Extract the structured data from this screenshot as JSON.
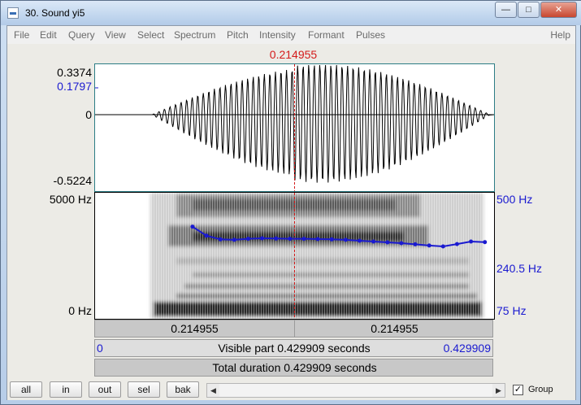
{
  "window": {
    "title": "30. Sound yi5",
    "controls": {
      "minimize": "—",
      "maximize": "□",
      "close": "✕"
    }
  },
  "menu": {
    "items": [
      "File",
      "Edit",
      "Query",
      "View",
      "Select",
      "Spectrum",
      "Pitch",
      "Intensity",
      "Formant",
      "Pulses"
    ],
    "help": "Help"
  },
  "cursor": {
    "time_label": "0.214955",
    "time": 0.214955,
    "color": "#d41b1b"
  },
  "waveform": {
    "top_label": "0.3374",
    "value_label": "0.1797",
    "zero_label": "0",
    "bottom_label": "-0.5224",
    "top": 0.3374,
    "bottom": -0.5224,
    "marked_value": 0.1797
  },
  "spectrogram": {
    "freq_top_label": "5000 Hz",
    "freq_bottom_label": "0 Hz",
    "pitch_top_label": "500 Hz",
    "pitch_mid_label": "240.5 Hz",
    "pitch_bottom_label": "75 Hz",
    "pitch_floor": 75,
    "pitch_ceiling": 500,
    "pitch_color": "#1a1ad0"
  },
  "chart_data": {
    "type": "line",
    "title": "",
    "xlabel": "",
    "ylabel": "",
    "xlim": [
      0,
      0.429909
    ],
    "ylim": [
      75,
      500
    ],
    "series": [
      {
        "x": [
          0.105,
          0.12,
          0.135,
          0.15,
          0.165,
          0.18,
          0.195,
          0.21,
          0.225,
          0.24,
          0.255,
          0.27,
          0.285,
          0.3,
          0.315,
          0.33,
          0.345,
          0.36,
          0.375,
          0.39,
          0.405,
          0.42
        ],
        "values": [
          300,
          262,
          248,
          246,
          250,
          252,
          251,
          250,
          250,
          249,
          248,
          246,
          243,
          240,
          237,
          234,
          230,
          226,
          223,
          231,
          240,
          238
        ]
      }
    ]
  },
  "selection": {
    "left_time": "0.214955",
    "right_time": "0.214955",
    "visible_start": "0",
    "visible_text": "Visible part 0.429909 seconds",
    "visible_end": "0.429909",
    "total_text": "Total duration 0.429909 seconds"
  },
  "toolbar": {
    "buttons": [
      "all",
      "in",
      "out",
      "sel",
      "bak"
    ],
    "scroll_left": "◀",
    "scroll_right": "▶",
    "group_label": "Group",
    "group_checked": "✓"
  }
}
